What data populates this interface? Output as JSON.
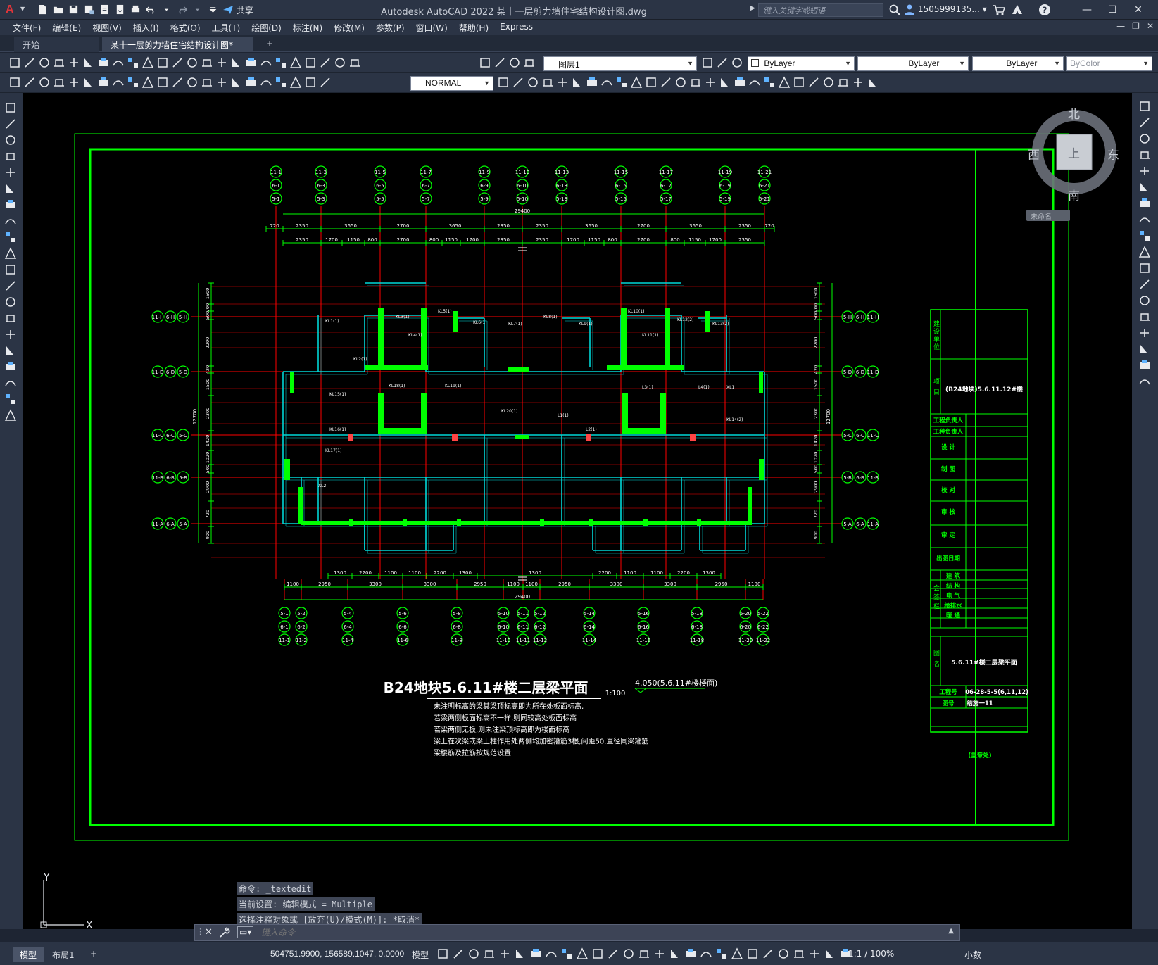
{
  "title_bar": {
    "window_title": "Autodesk AutoCAD 2022    某十一层剪力墙住宅结构设计图.dwg",
    "share_label": "共享",
    "search_placeholder": "键入关键字或短语",
    "user_name": "1505999135...",
    "logo_letter": "A"
  },
  "menu": {
    "items": [
      "文件(F)",
      "编辑(E)",
      "视图(V)",
      "插入(I)",
      "格式(O)",
      "工具(T)",
      "绘图(D)",
      "标注(N)",
      "修改(M)",
      "参数(P)",
      "窗口(W)",
      "帮助(H)",
      "Express"
    ]
  },
  "doc_tabs": {
    "start": "开始",
    "drawing": "某十一层剪力墙住宅结构设计图*",
    "close_glyph": "✕",
    "add_glyph": "+"
  },
  "toolbar": {
    "layer_value": "图层1",
    "text_style_value": "NORMAL",
    "color_value": "ByLayer",
    "linetype_value": "ByLayer",
    "lineweight_value": "ByLayer",
    "plotstyle_value": "ByColor"
  },
  "viewcube": {
    "north": "北",
    "south": "南",
    "east": "东",
    "west": "西",
    "face": "上",
    "unnamed_view": "未命名"
  },
  "drawing": {
    "plan_title": "B24地块5.6.11#楼二层梁平面",
    "plan_scale": "1:100",
    "elevation_note": "4.050(5.6.11#楼楼面)",
    "notes": [
      "未注明标高的梁其梁顶标高即为所在处板面标高,",
      "若梁两侧板面标高不一样,则同较高处板面标高",
      "若梁两侧无板,则未注梁顶标高即为楼面标高",
      "梁上在次梁或梁上柱作用处两侧均加密箍筋3根,间距50,直径同梁箍筋",
      "梁腰筋及拉筋按规范设置"
    ],
    "dims_top_row1": [
      "720",
      "2350",
      "3650",
      "2700",
      "3650",
      "2350",
      "2350",
      "3650",
      "2700",
      "3650",
      "2350",
      "720"
    ],
    "dims_top_row2": [
      "2350",
      "1700",
      "1150",
      "800",
      "2700",
      "800",
      "1150",
      "1700",
      "2350",
      "2350",
      "1700",
      "1150",
      "800",
      "2700",
      "800",
      "1150",
      "1700",
      "2350"
    ],
    "dims_bottom_row": [
      "1100",
      "2950",
      "3300",
      "3300",
      "2950",
      "1100",
      "1100",
      "2950",
      "3300",
      "3300",
      "2950",
      "1100"
    ],
    "dims_bottom_row2": [
      "1300",
      "2200",
      "1100",
      "1100",
      "2200",
      "1300",
      "1300",
      "2200",
      "1100",
      "1100",
      "2200",
      "1300"
    ],
    "total_width": "29400",
    "dims_left": [
      "1500",
      "700",
      "500",
      "2200",
      "420",
      "1500",
      "2300",
      "1420",
      "1020",
      "500",
      "2900",
      "720",
      "900"
    ],
    "left_total": "12700",
    "top_axes_row1": [
      "11-1",
      "11-3",
      "11-5",
      "11-7",
      "11-9",
      "11-10",
      "11-13",
      "11-15",
      "11-17",
      "11-19",
      "11-21"
    ],
    "top_axes_row2": [
      "6-1",
      "6-3",
      "6-5",
      "6-7",
      "6-9",
      "6-10",
      "6-13",
      "6-15",
      "6-17",
      "6-19",
      "6-21"
    ],
    "top_axes_row3": [
      "5-1",
      "5-3",
      "5-5",
      "5-7",
      "5-9",
      "5-10",
      "5-13",
      "5-15",
      "5-17",
      "5-19",
      "5-21"
    ],
    "bottom_axes_row1": [
      "5-1",
      "5-2",
      "5-4",
      "5-6",
      "5-8",
      "5-10",
      "5-11",
      "5-12",
      "5-14",
      "5-16",
      "5-18",
      "5-20",
      "5-22"
    ],
    "bottom_axes_row2": [
      "6-1",
      "6-2",
      "6-4",
      "6-6",
      "6-8",
      "6-10",
      "6-11",
      "6-12",
      "6-14",
      "6-16",
      "6-18",
      "6-20",
      "6-22"
    ],
    "bottom_axes_row3": [
      "11-1",
      "11-2",
      "11-4",
      "11-6",
      "11-8",
      "11-10",
      "11-11",
      "11-12",
      "11-14",
      "11-16",
      "11-18",
      "11-20",
      "11-22"
    ],
    "left_axes": [
      [
        "11-H",
        "6-H",
        "5-H"
      ],
      [
        "11-D",
        "6-D",
        "5-D"
      ],
      [
        "11-C",
        "6-C",
        "5-C"
      ],
      [
        "11-B",
        "6-B",
        "5-B"
      ],
      [
        "11-A",
        "6-A",
        "5-A"
      ]
    ],
    "right_axes": [
      [
        "5-H",
        "6-H",
        "11-H"
      ],
      [
        "5-D",
        "6-D",
        "11-D"
      ],
      [
        "5-C",
        "6-C",
        "11-C"
      ],
      [
        "5-B",
        "6-B",
        "11-B"
      ],
      [
        "5-A",
        "6-A",
        "11-A"
      ]
    ],
    "beam_labels": [
      "KL1(1)",
      "KL2(1)",
      "KL3(1)",
      "KL4(1)",
      "KL5(1)",
      "KL6(1)",
      "KL7(1)",
      "KL8(1)",
      "KL9(1)",
      "KL10(1)",
      "KL11(1)",
      "KL12(2)",
      "KL13(2)",
      "KL14(2)",
      "KL15(1)",
      "KL16(1)",
      "KL17(1)",
      "KL18(1)",
      "KL19(1)",
      "KL20(1)",
      "L1(1)",
      "L2(1)",
      "L3(1)",
      "L4(1)",
      "XL1",
      "XL2"
    ]
  },
  "title_block": {
    "unit_label": "建设单位",
    "project_label": "项目",
    "project_value": "(B24地块)5.6.11.12#楼",
    "rows": [
      "工程负责人",
      "工种负责人",
      "设  计",
      "制  图",
      "校  对",
      "审  核",
      "审  定",
      "出图日期"
    ],
    "sign_label": "会签栏",
    "sign_rows": [
      "建 筑",
      "结 构",
      "电 气",
      "给排水",
      "暖 通"
    ],
    "drawing_name_label": "图名",
    "drawing_name_value": "5.6.11#楼二层梁平面",
    "project_no_label": "工程号",
    "project_no_value": "06-28-5-5(6,11,12)",
    "drawing_no_label": "图号",
    "drawing_no_value": "结施一11",
    "stamp": "(盖章处)"
  },
  "command_line": {
    "history": [
      "命令: _textedit",
      "当前设置: 编辑模式 = Multiple",
      "选择注释对象或 [放弃(U)/模式(M)]: *取消*"
    ],
    "placeholder": "键入命令"
  },
  "ucs": {
    "x_label": "X",
    "y_label": "Y"
  },
  "status_bar": {
    "tab_model": "模型",
    "tab_layout1": "布局1",
    "tab_add": "+",
    "coordinates": "504751.9900, 156589.1047, 0.0000",
    "space_label": "模型",
    "annotation_scale": "1:1 / 100%",
    "units": "小数"
  },
  "colors": {
    "canvas_bg": "#000000",
    "border_green": "#00ff00",
    "wall_green": "#00ff00",
    "axis_red": "#ff0000",
    "beam_cyan": "#00d8d8",
    "text_white": "#ffffff",
    "ui_bg": "#2b3445"
  }
}
